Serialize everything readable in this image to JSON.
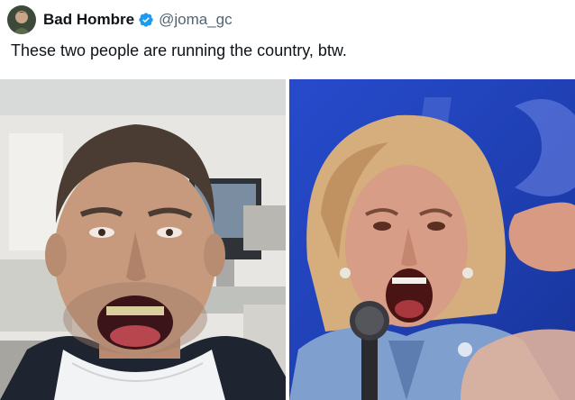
{
  "author": {
    "display_name": "Bad Hombre",
    "handle": "@joma_gc",
    "verified_icon": "verified-badge-icon",
    "verified_color": "#1d9bf0"
  },
  "tweet": {
    "text": "These two people are running the country, btw."
  },
  "media": [
    {
      "icon": "photo-left"
    },
    {
      "icon": "photo-right"
    }
  ],
  "colors": {
    "text": "#0f1419",
    "secondary": "#536471",
    "stage_blue": "#1f3fb8"
  }
}
